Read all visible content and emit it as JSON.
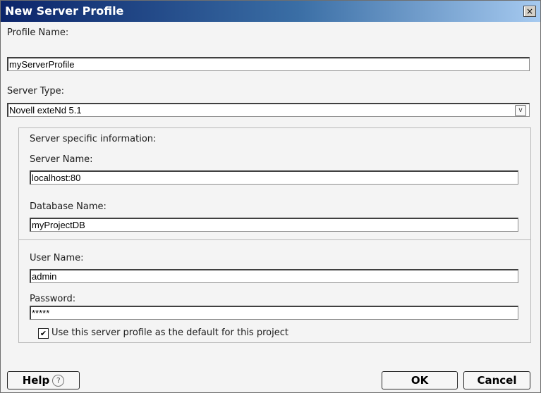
{
  "dialog": {
    "title": "New Server Profile",
    "close_glyph": "×"
  },
  "profile": {
    "name_label": "Profile Name:",
    "name_value": "myServerProfile",
    "type_label": "Server Type:",
    "type_value": "Novell exteNd 5.1"
  },
  "server_info": {
    "heading": "Server specific information:",
    "server_name_label": "Server Name:",
    "server_name_value": "localhost:80",
    "database_label": "Database Name:",
    "database_value": "myProjectDB"
  },
  "credentials": {
    "user_label": "User Name:",
    "user_value": "admin",
    "password_label": "Password:",
    "password_value": "*****",
    "default_checkbox_label": "Use this server profile as the default for this project",
    "default_checked": true
  },
  "buttons": {
    "help": "Help",
    "help_icon": "?",
    "ok": "OK",
    "cancel": "Cancel"
  }
}
